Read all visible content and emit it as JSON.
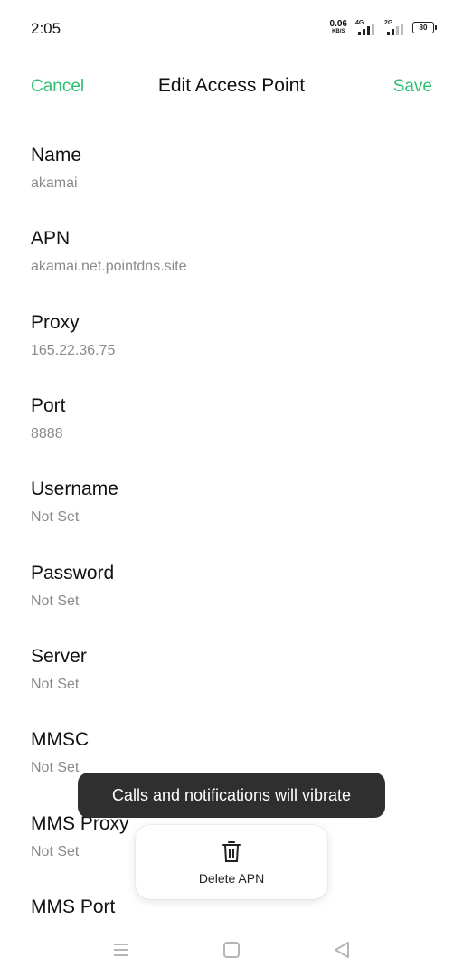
{
  "status_bar": {
    "time": "2:05",
    "net_speed_value": "0.06",
    "net_speed_unit": "KB/S",
    "signal_1_label": "4G",
    "signal_2_label": "2G",
    "battery_level": "80"
  },
  "header": {
    "cancel_label": "Cancel",
    "title": "Edit Access Point",
    "save_label": "Save"
  },
  "fields": [
    {
      "label": "Name",
      "value": "akamai"
    },
    {
      "label": "APN",
      "value": "akamai.net.pointdns.site"
    },
    {
      "label": "Proxy",
      "value": "165.22.36.75"
    },
    {
      "label": "Port",
      "value": "8888"
    },
    {
      "label": "Username",
      "value": "Not Set"
    },
    {
      "label": "Password",
      "value": "Not Set"
    },
    {
      "label": "Server",
      "value": "Not Set"
    },
    {
      "label": "MMSC",
      "value": "Not Set"
    },
    {
      "label": "MMS Proxy",
      "value": "Not Set"
    },
    {
      "label": "MMS Port",
      "value": ""
    }
  ],
  "toast": {
    "message": "Calls and notifications will vibrate"
  },
  "delete_action": {
    "label": "Delete APN",
    "icon": "trash-icon"
  },
  "nav_bar": {
    "icons": [
      "menu-icon",
      "home-icon",
      "back-icon"
    ]
  },
  "colors": {
    "accent": "#2fbf73",
    "toast_bg": "#2f2f2f",
    "secondary_text": "#8a8a8a"
  }
}
